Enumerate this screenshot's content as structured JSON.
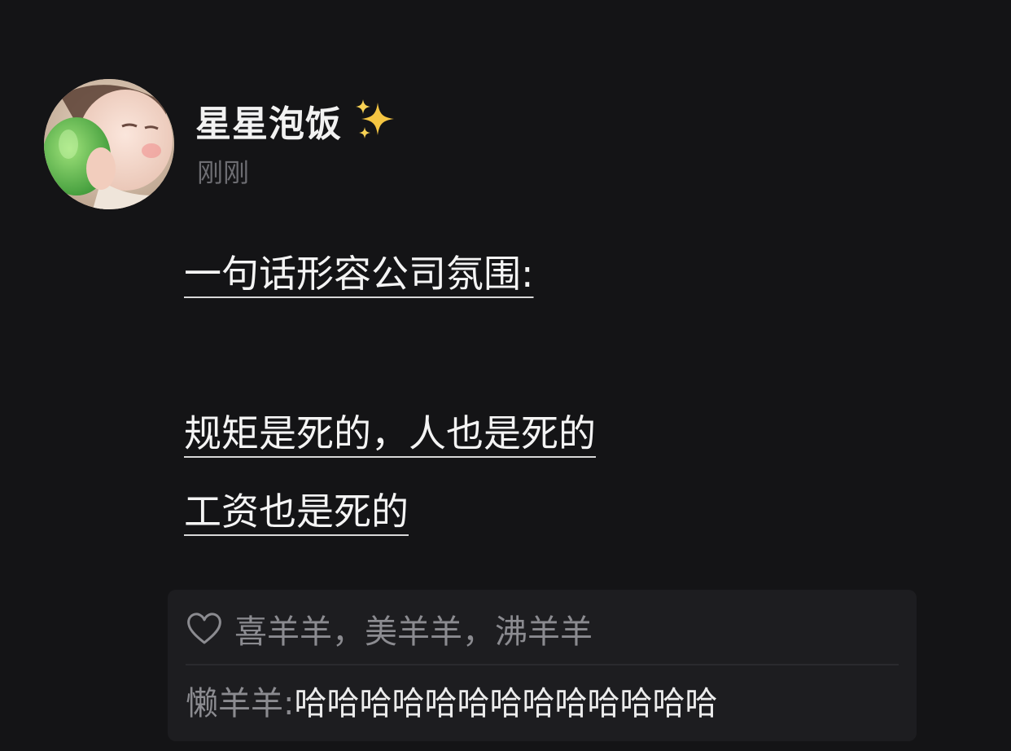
{
  "post": {
    "author": {
      "name": "星星泡饭",
      "avatar_icon": "avatar-baby-drinking"
    },
    "timestamp": "刚刚",
    "content_lines": [
      "一句话形容公司氛围:",
      "规矩是死的，人也是死的",
      "工资也是死的"
    ]
  },
  "interactions": {
    "likes_icon": "heart-icon",
    "likes": "喜羊羊，美羊羊，沸羊羊",
    "comment": {
      "author": "懒羊羊: ",
      "text": "哈哈哈哈哈哈哈哈哈哈哈哈哈"
    }
  },
  "colors": {
    "background": "#141416",
    "panel": "#1d1d20",
    "primary_text": "#f2f2f2",
    "secondary_text": "#8b8b90",
    "sparkle": "#f4c542"
  }
}
